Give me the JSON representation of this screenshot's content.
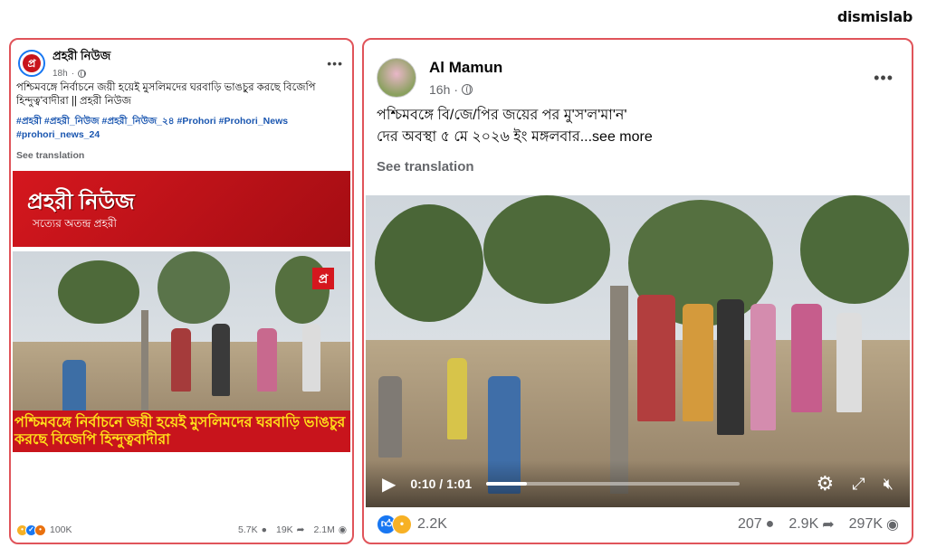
{
  "brand": "dismislab",
  "left_post": {
    "page_name": "প্রহরী নিউজ",
    "time": "18h",
    "text": "পশ্চিমবঙ্গে নির্বাচনে জয়ী হয়েই মুসলিমদের ঘরবাড়ি ভাঙচুর করছে বিজেপি হিন্দুত্ব'বাদীরা || প্রহরী নিউজ",
    "hashtags": [
      "#প্রহরী",
      "#প্রহরী_নিউজ",
      "#প্রহরী_নিউজ_২৪",
      "#Prohori",
      "#Prohori_News",
      "#prohori_news_24"
    ],
    "see_translation": "See translation",
    "banner_title": "প্রহরী নিউজ",
    "banner_subtitle": "সত্যের অতন্দ্র প্রহরী",
    "caption": "পশ্চিমবঙ্গে নির্বাচনে জয়ী হয়েই মুসলিমদের ঘরবাড়ি ভাঙচুর করছে বিজেপি হিন্দুত্ববাদীরা",
    "reactions": "100K",
    "comments": "5.7K",
    "shares": "19K",
    "views": "2.1M",
    "colors": {
      "banner": "#c8141c",
      "hashtag": "#1a56b0"
    }
  },
  "right_post": {
    "user_name": "Al Mamun",
    "time": "16h",
    "text_line1": "পশ্চিমবঙ্গে বি/জে/পির জয়ের পর মু'স'ল'মা'ন'",
    "text_line2": "দের অবস্থা ৫ মে ২০২৬ ইং মঙ্গলবার",
    "see_more": "...see more",
    "see_translation": "See translation",
    "video_time": "0:10 / 1:01",
    "video_progress": 0.16,
    "reactions": "2.2K",
    "comments": "207",
    "shares": "2.9K",
    "views": "297K"
  },
  "icons": [
    "menu-dots-icon",
    "globe-icon",
    "like-reaction-icon",
    "sad-reaction-icon",
    "angry-reaction-icon",
    "comment-icon",
    "share-icon",
    "eye-icon",
    "play-icon",
    "settings-icon",
    "fullscreen-icon",
    "volume-mute-icon"
  ]
}
